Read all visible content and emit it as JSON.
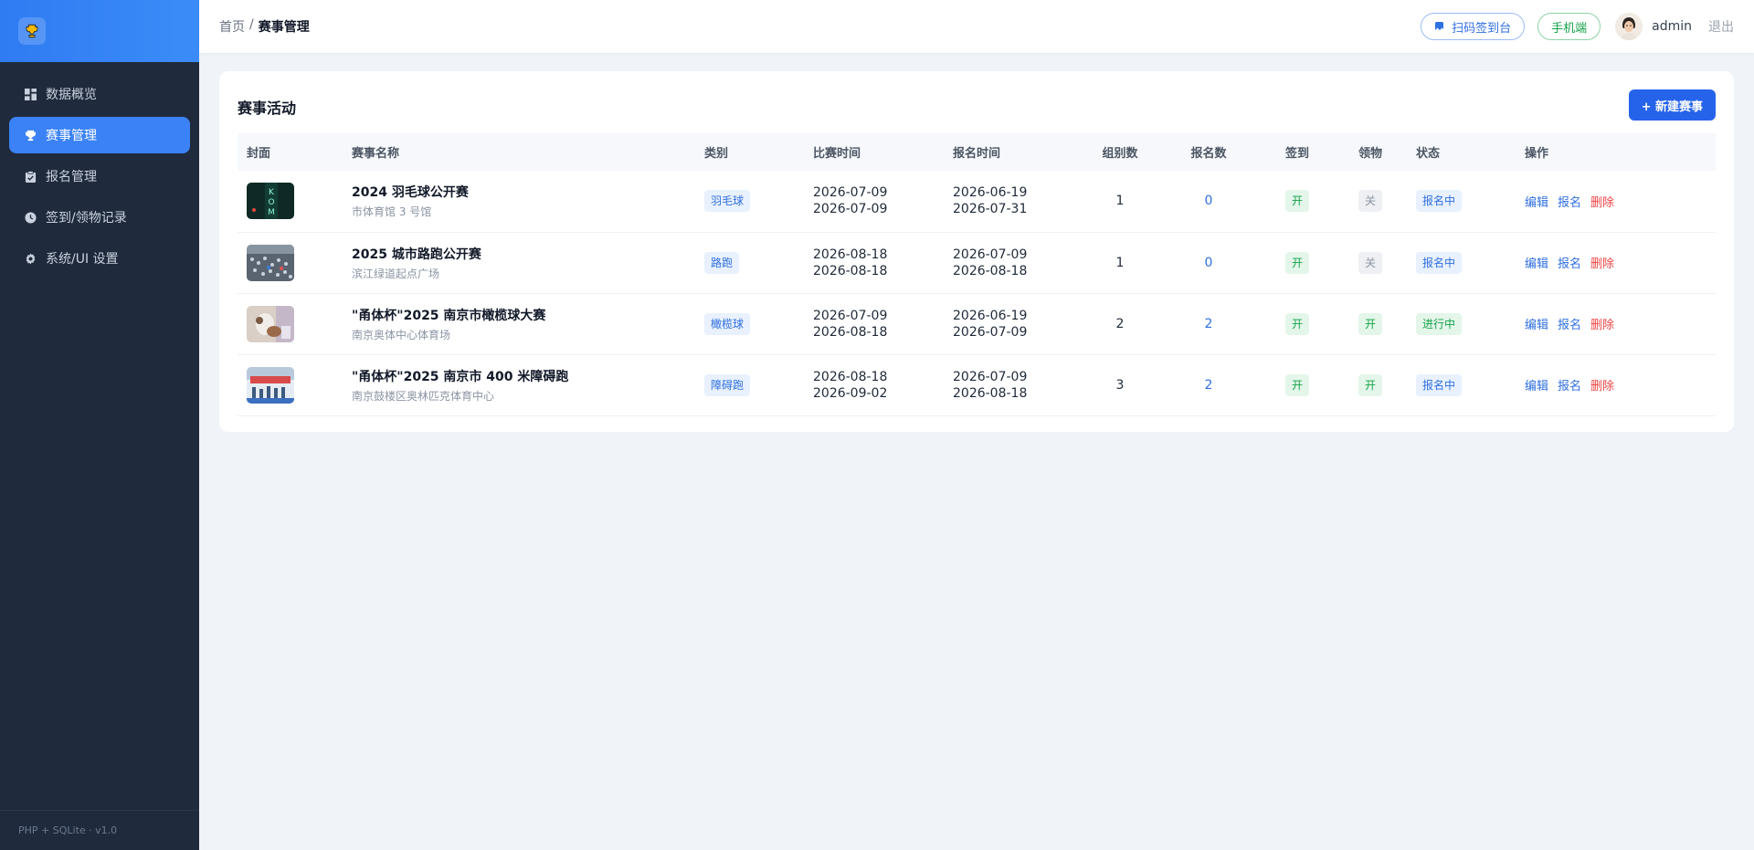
{
  "sidebar": {
    "brand_icon": "trophy-icon",
    "items": [
      {
        "label": "数据概览",
        "icon": "dashboard-icon",
        "active": false
      },
      {
        "label": "赛事管理",
        "icon": "trophy-icon",
        "active": true
      },
      {
        "label": "报名管理",
        "icon": "clipboard-icon",
        "active": false
      },
      {
        "label": "签到/领物记录",
        "icon": "clock-icon",
        "active": false
      },
      {
        "label": "系统/UI 设置",
        "icon": "gear-icon",
        "active": false
      }
    ],
    "footer": "PHP + SQLite · v1.0"
  },
  "topbar": {
    "breadcrumb": {
      "home": "首页",
      "separator": "/",
      "current": "赛事管理"
    },
    "scan_button": "扫码签到台",
    "mobile_button": "手机端",
    "username": "admin",
    "logout": "退出"
  },
  "card": {
    "title": "赛事活动",
    "new_button": "+ 新建赛事",
    "columns": [
      "封面",
      "赛事名称",
      "类别",
      "比赛时间",
      "报名时间",
      "组别数",
      "报名数",
      "签到",
      "领物",
      "状态",
      "操作"
    ],
    "rows": [
      {
        "name": "2024 羽毛球公开赛",
        "venue": "市体育馆 3 号馆",
        "category": "羽毛球",
        "match_start": "2026-07-09",
        "match_end": "2026-07-09",
        "reg_start": "2026-06-19",
        "reg_end": "2026-07-31",
        "groups": "1",
        "signups": "0",
        "checkin": "开",
        "pickup": "关",
        "status": "报名中"
      },
      {
        "name": "2025 城市路跑公开赛",
        "venue": "滨江绿道起点广场",
        "category": "路跑",
        "match_start": "2026-08-18",
        "match_end": "2026-08-18",
        "reg_start": "2026-07-09",
        "reg_end": "2026-08-18",
        "groups": "1",
        "signups": "0",
        "checkin": "开",
        "pickup": "关",
        "status": "报名中"
      },
      {
        "name": "\"甬体杯\"2025 南京市橄榄球大赛",
        "venue": "南京奥体中心体育场",
        "category": "橄榄球",
        "match_start": "2026-07-09",
        "match_end": "2026-08-18",
        "reg_start": "2026-06-19",
        "reg_end": "2026-07-09",
        "groups": "2",
        "signups": "2",
        "checkin": "开",
        "pickup": "开",
        "status": "进行中"
      },
      {
        "name": "\"甬体杯\"2025 南京市 400 米障碍跑",
        "venue": "南京鼓楼区奥林匹克体育中心",
        "category": "障碍跑",
        "match_start": "2026-08-18",
        "match_end": "2026-09-02",
        "reg_start": "2026-07-09",
        "reg_end": "2026-08-18",
        "groups": "3",
        "signups": "2",
        "checkin": "开",
        "pickup": "开",
        "status": "报名中"
      }
    ],
    "actions": {
      "edit": "编辑",
      "enroll": "报名",
      "delete": "删除"
    }
  },
  "colors": {
    "accent": "#3b82f6",
    "sidebar_bg": "#1f2a3c",
    "danger": "#ef4444",
    "success": "#16a34a"
  }
}
